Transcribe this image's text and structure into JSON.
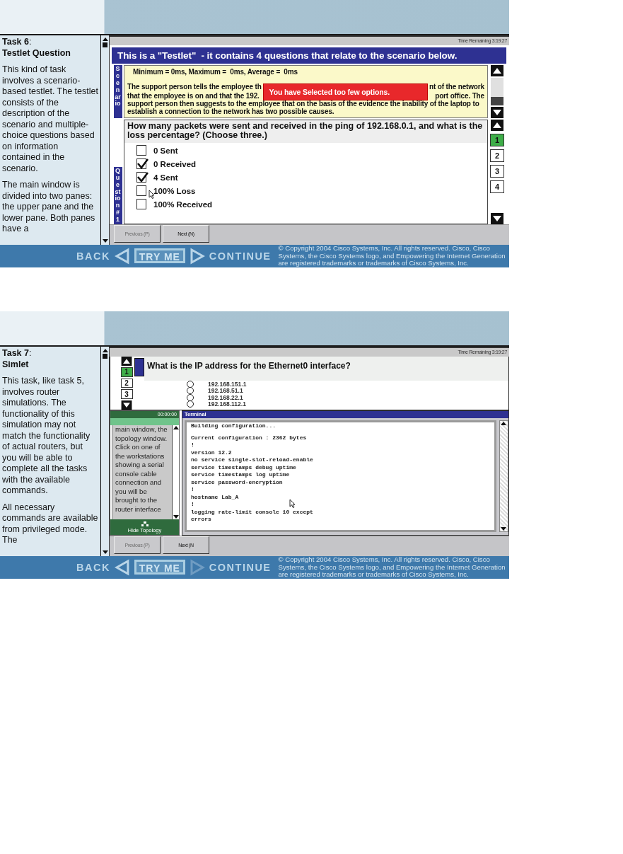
{
  "panels": [
    {
      "kind": "testlet",
      "sidebar": {
        "task": "**Task 6**:",
        "title": "Testlet Question",
        "paragraphs": [
          "This kind of task involves a scenario-based testlet.  The testlet consists of the description of the scenario and multiple-choice questions based on information contained in the scenario.",
          "The main window is divided into two panes: the upper pane and the lower pane. Both panes have a"
        ]
      },
      "time_remaining": "Time Remaining 3:19:27",
      "banner": "This is a \"Testlet\"  - it contains 4 questions that relate to the scenario below.",
      "scenario": {
        "tab": "Scenario",
        "stats": "Minimum = 0ms, Maximum =  0ms, Average =  0ms",
        "covered_lines": [
          {
            "left": "The support person tells the employee th",
            "right": "nt of the network"
          },
          {
            "left": "that the employee is on and that the 192.",
            "right": "port office. The"
          }
        ],
        "alert": "You have Selected too few options.",
        "rest": "support person then suggests to the employee that on the basis of the evidence the inability of the laptop to establish a connection to the network has two possible causes."
      },
      "question": {
        "tab": "Question #1",
        "text": "How many packets were sent and received in the ping of 192.168.0.1,  and what is the loss percentage? (Choose three.)",
        "options": [
          {
            "label": "0 Sent",
            "checked": false
          },
          {
            "label": "0 Received",
            "checked": true
          },
          {
            "label": "4 Sent",
            "checked": true
          },
          {
            "label": "100% Loss",
            "checked": false
          },
          {
            "label": "100% Received",
            "checked": false
          }
        ]
      },
      "question_numbers": [
        {
          "label": "1",
          "selected": true
        },
        {
          "label": "2",
          "selected": false
        },
        {
          "label": "3",
          "selected": false
        },
        {
          "label": "4",
          "selected": false
        }
      ],
      "buttons": [
        {
          "label": "Previous (P)",
          "disabled": true
        },
        {
          "label": "Next (N)",
          "disabled": false
        }
      ],
      "footer": {
        "back": "BACK",
        "try_me": "TRY ME",
        "continue": "CONTINUE",
        "continue_disabled": false,
        "copyright": "© Copyright 2004 Cisco Systems, Inc. All rights reserved. Cisco, Cisco Systems, the Cisco Systems logo, and Empowering the Internet Generation are registered trademarks or trademarks of Cisco Systems, Inc."
      }
    },
    {
      "kind": "simlet",
      "sidebar": {
        "task": "**Task 7**:",
        "title": "Simlet",
        "paragraphs": [
          "This task, like task 5, involves router simulations. The functionality of this simulation may not match the functionality of actual routers, but you will be able to complete all the tasks with the available commands.",
          "All necessary commands are available from privileged mode. The"
        ]
      },
      "time_remaining": "Time Remaining 3:19:27",
      "question_numbers": [
        {
          "label": "1",
          "selected": true
        },
        {
          "label": "2",
          "selected": false
        },
        {
          "label": "3",
          "selected": false
        }
      ],
      "question": {
        "text": "What is the IP address for the Ethernet0 interface?",
        "options": [
          {
            "label": "192.168.151.1",
            "selected": false
          },
          {
            "label": "192.168.51.1",
            "selected": false
          },
          {
            "label": "192.168.22.1",
            "selected": false
          },
          {
            "label": "192.168.112.1",
            "selected": false
          }
        ]
      },
      "topology": {
        "timer": "00:00:00",
        "text": "main window, the topology window. Click on one of the workstations showing a serial console cable connection and you will be brought to the router interface",
        "hide": "Hide Topology"
      },
      "terminal": {
        "title": "Terminal",
        "blocks": [
          [
            "Building configuration..."
          ],
          [
            "Current configuration : 2362 bytes",
            "!",
            "version 12.2",
            "no service single-slot-reload-enable",
            "service timestamps debug uptime",
            "service timestamps log uptime",
            "service password-encryption",
            "!",
            "hostname Lab_A",
            "!",
            "logging rate-limit console 10 except",
            "errors"
          ]
        ]
      },
      "buttons": [
        {
          "label": "Previous (P)",
          "disabled": true
        },
        {
          "label": "Next (N",
          "disabled": false
        }
      ],
      "footer": {
        "back": "BACK",
        "try_me": "TRY ME",
        "continue": "CONTINUE",
        "continue_disabled": true,
        "copyright": "© Copyright 2004 Cisco Systems, Inc. All rights reserved. Cisco, Cisco Systems, the Cisco Systems logo, and Empowering the Internet Generation are registered trademarks or trademarks of Cisco Systems, Inc."
      }
    }
  ]
}
